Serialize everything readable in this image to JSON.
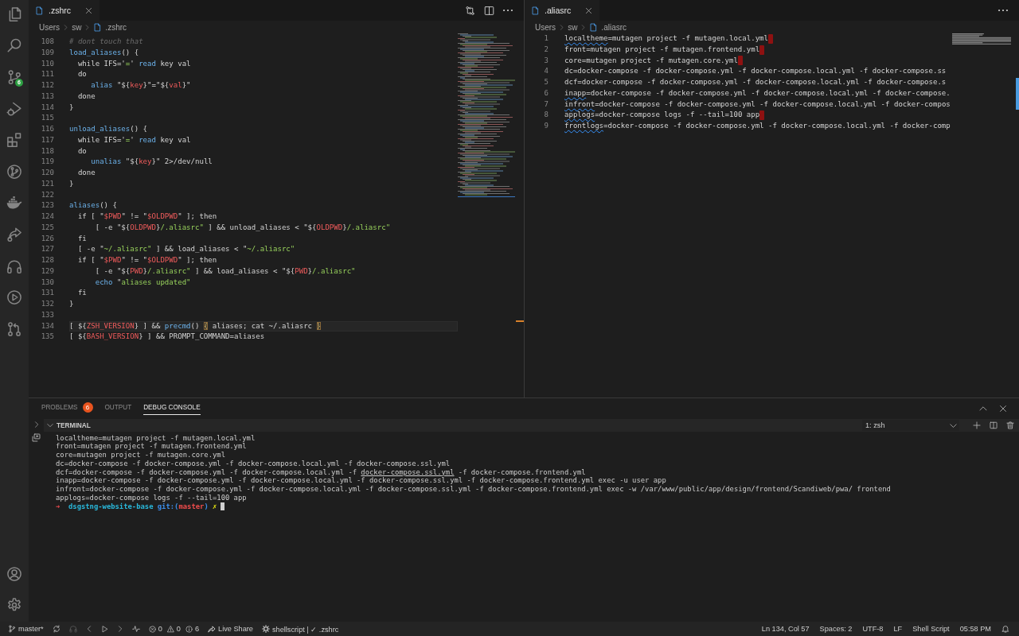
{
  "activity_bar": {
    "badge": "6"
  },
  "editors": [
    {
      "tab": {
        "label": ".zshrc",
        "selected": true
      },
      "breadcrumbs": [
        "Users",
        "sw",
        ".zshrc"
      ],
      "lines": [
        {
          "number": "108",
          "current": false,
          "tokens": [
            {
              "kind": "comment",
              "text": "# dont touch that"
            }
          ]
        },
        {
          "number": "109",
          "current": false,
          "tokens": [
            {
              "kind": "func",
              "text": "load_aliases"
            },
            {
              "kind": "text",
              "text": "() {"
            }
          ]
        },
        {
          "number": "110",
          "current": false,
          "tokens": [
            {
              "kind": "text",
              "text": "  while IFS='"
            },
            {
              "kind": "str",
              "text": "="
            },
            {
              "kind": "text",
              "text": "' "
            },
            {
              "kind": "func",
              "text": "read"
            },
            {
              "kind": "text",
              "text": " key val"
            }
          ]
        },
        {
          "number": "111",
          "current": false,
          "tokens": [
            {
              "kind": "text",
              "text": "  do"
            }
          ]
        },
        {
          "number": "112",
          "current": false,
          "tokens": [
            {
              "kind": "func",
              "text": "     alias"
            },
            {
              "kind": "text",
              "text": " \"${"
            },
            {
              "kind": "var",
              "text": "key"
            },
            {
              "kind": "text",
              "text": "}\"=\"${"
            },
            {
              "kind": "var",
              "text": "val"
            },
            {
              "kind": "text",
              "text": "}\""
            }
          ]
        },
        {
          "number": "113",
          "current": false,
          "tokens": [
            {
              "kind": "text",
              "text": "  done"
            }
          ]
        },
        {
          "number": "114",
          "current": false,
          "tokens": [
            {
              "kind": "text",
              "text": "}"
            }
          ]
        },
        {
          "number": "115",
          "current": false
        },
        {
          "number": "116",
          "current": false,
          "tokens": [
            {
              "kind": "func",
              "text": "unload_aliases"
            },
            {
              "kind": "text",
              "text": "() {"
            }
          ]
        },
        {
          "number": "117",
          "current": false,
          "tokens": [
            {
              "kind": "text",
              "text": "  while IFS='"
            },
            {
              "kind": "str",
              "text": "="
            },
            {
              "kind": "text",
              "text": "' "
            },
            {
              "kind": "func",
              "text": "read"
            },
            {
              "kind": "text",
              "text": " key val"
            }
          ]
        },
        {
          "number": "118",
          "current": false,
          "tokens": [
            {
              "kind": "text",
              "text": "  do"
            }
          ]
        },
        {
          "number": "119",
          "current": false,
          "tokens": [
            {
              "kind": "func",
              "text": "     unalias"
            },
            {
              "kind": "text",
              "text": " \"${"
            },
            {
              "kind": "var",
              "text": "key"
            },
            {
              "kind": "text",
              "text": "}\" 2>/dev/null"
            }
          ]
        },
        {
          "number": "120",
          "current": false,
          "tokens": [
            {
              "kind": "text",
              "text": "  done"
            }
          ]
        },
        {
          "number": "121",
          "current": false,
          "tokens": [
            {
              "kind": "text",
              "text": "}"
            }
          ]
        },
        {
          "number": "122",
          "current": false
        },
        {
          "number": "123",
          "current": false,
          "tokens": [
            {
              "kind": "func",
              "text": "aliases"
            },
            {
              "kind": "text",
              "text": "() {"
            }
          ]
        },
        {
          "number": "124",
          "current": false,
          "tokens": [
            {
              "kind": "text",
              "text": "  if [ \""
            },
            {
              "kind": "var",
              "text": "$PWD"
            },
            {
              "kind": "text",
              "text": "\" != \""
            },
            {
              "kind": "var",
              "text": "$OLDPWD"
            },
            {
              "kind": "text",
              "text": "\" ]; then"
            }
          ]
        },
        {
          "number": "125",
          "current": false,
          "tokens": [
            {
              "kind": "text",
              "text": "      [ -e \"${"
            },
            {
              "kind": "var",
              "text": "OLDPWD"
            },
            {
              "kind": "text",
              "text": "}"
            },
            {
              "kind": "str",
              "text": "/.aliasrc\""
            },
            {
              "kind": "text",
              "text": " ] && unload_aliases < \"${"
            },
            {
              "kind": "var",
              "text": "OLDPWD"
            },
            {
              "kind": "text",
              "text": "}"
            },
            {
              "kind": "str",
              "text": "/.aliasrc\""
            }
          ]
        },
        {
          "number": "126",
          "current": false,
          "tokens": [
            {
              "kind": "text",
              "text": "  fi"
            }
          ]
        },
        {
          "number": "127",
          "current": false,
          "tokens": [
            {
              "kind": "text",
              "text": "  [ -e \""
            },
            {
              "kind": "str",
              "text": "~/.aliasrc\""
            },
            {
              "kind": "text",
              "text": " ] && load_aliases < \""
            },
            {
              "kind": "str",
              "text": "~/.aliasrc\""
            }
          ]
        },
        {
          "number": "128",
          "current": false,
          "tokens": [
            {
              "kind": "text",
              "text": "  if [ \""
            },
            {
              "kind": "var",
              "text": "$PWD"
            },
            {
              "kind": "text",
              "text": "\" != \""
            },
            {
              "kind": "var",
              "text": "$OLDPWD"
            },
            {
              "kind": "text",
              "text": "\" ]; then"
            }
          ]
        },
        {
          "number": "129",
          "current": false,
          "tokens": [
            {
              "kind": "text",
              "text": "      [ -e \"${"
            },
            {
              "kind": "var",
              "text": "PWD"
            },
            {
              "kind": "text",
              "text": "}"
            },
            {
              "kind": "str",
              "text": "/.aliasrc\""
            },
            {
              "kind": "text",
              "text": " ] && load_aliases < \"${"
            },
            {
              "kind": "var",
              "text": "PWD"
            },
            {
              "kind": "text",
              "text": "}"
            },
            {
              "kind": "str",
              "text": "/.aliasrc\""
            }
          ]
        },
        {
          "number": "130",
          "current": false,
          "tokens": [
            {
              "kind": "func",
              "text": "      echo"
            },
            {
              "kind": "text",
              "text": " \""
            },
            {
              "kind": "str",
              "text": "aliases updated\""
            }
          ]
        },
        {
          "number": "131",
          "current": false,
          "tokens": [
            {
              "kind": "text",
              "text": "  fi"
            }
          ]
        },
        {
          "number": "132",
          "current": false,
          "tokens": [
            {
              "kind": "text",
              "text": "}"
            }
          ]
        },
        {
          "number": "133",
          "current": false
        },
        {
          "number": "134",
          "current": true,
          "tokens": [
            {
              "kind": "text",
              "text": "[ ${"
            },
            {
              "kind": "var",
              "text": "ZSH_VERSION"
            },
            {
              "kind": "text",
              "text": "} ] && "
            },
            {
              "kind": "func",
              "text": "precmd"
            },
            {
              "kind": "text",
              "text": "() "
            },
            {
              "kind": "bracket",
              "text": "{"
            },
            {
              "kind": "text",
              "text": " aliases; cat ~/.aliasrc "
            },
            {
              "kind": "bracket",
              "text": "}"
            }
          ]
        },
        {
          "number": "135",
          "current": false,
          "tokens": [
            {
              "kind": "text",
              "text": "[ ${"
            },
            {
              "kind": "var",
              "text": "BASH_VERSION"
            },
            {
              "kind": "text",
              "text": "} ] && PROMPT_COMMAND=aliases"
            }
          ]
        }
      ]
    },
    {
      "tab": {
        "label": ".aliasrc",
        "selected": true
      },
      "breadcrumbs": [
        "Users",
        "sw",
        ".aliasrc"
      ],
      "lines": [
        {
          "number": "1",
          "current": false,
          "trailing_space": true,
          "tokens": [
            {
              "kind": "misspelled",
              "text": "localtheme"
            },
            {
              "kind": "text",
              "text": "=mutagen project -f mutagen.local.yml"
            }
          ]
        },
        {
          "number": "2",
          "current": false,
          "trailing_space": true,
          "tokens": [
            {
              "kind": "text",
              "text": "front=mutagen project -f mutagen.frontend.yml"
            }
          ]
        },
        {
          "number": "3",
          "current": false,
          "trailing_space": true,
          "tokens": [
            {
              "kind": "text",
              "text": "core=mutagen project -f mutagen.core.yml"
            }
          ]
        },
        {
          "number": "4",
          "current": false,
          "trailing_space": false,
          "tokens": [
            {
              "kind": "text",
              "text": "dc=docker-compose -f docker-compose.yml -f docker-compose.local.yml -f docker-compose.ss"
            }
          ]
        },
        {
          "number": "5",
          "current": false,
          "trailing_space": false,
          "tokens": [
            {
              "kind": "text",
              "text": "dcf=docker-compose -f docker-compose.yml -f docker-compose.local.yml -f docker-compose.s"
            }
          ]
        },
        {
          "number": "6",
          "current": false,
          "trailing_space": false,
          "tokens": [
            {
              "kind": "misspelled",
              "text": "inapp"
            },
            {
              "kind": "text",
              "text": "=docker-compose -f docker-compose.yml -f docker-compose.local.yml -f docker-compose."
            }
          ]
        },
        {
          "number": "7",
          "current": false,
          "trailing_space": false,
          "tokens": [
            {
              "kind": "misspelled",
              "text": "infront"
            },
            {
              "kind": "text",
              "text": "=docker-compose -f docker-compose.yml -f docker-compose.local.yml -f docker-compos"
            }
          ]
        },
        {
          "number": "8",
          "current": false,
          "trailing_space": true,
          "tokens": [
            {
              "kind": "misspelled",
              "text": "applogs"
            },
            {
              "kind": "text",
              "text": "=docker-compose logs -f --tail=100 app"
            }
          ]
        },
        {
          "number": "9",
          "current": false,
          "trailing_space": false,
          "tokens": [
            {
              "kind": "misspelled",
              "text": "frontlogs"
            },
            {
              "kind": "text",
              "text": "=docker-compose -f docker-compose.yml -f docker-compose.local.yml -f docker-comp"
            }
          ]
        }
      ]
    }
  ],
  "panel": {
    "tabs": [
      {
        "label": "PROBLEMS",
        "badge": "6",
        "selected": false
      },
      {
        "label": "OUTPUT",
        "selected": false
      },
      {
        "label": "DEBUG CONSOLE",
        "selected": true
      }
    ],
    "section": {
      "title": "TERMINAL",
      "expanded": true
    },
    "terminal_picker": "1: zsh",
    "terminal": {
      "cursor": true,
      "lines": [
        {
          "tokens": [
            {
              "kind": "text",
              "text": "localtheme=mutagen project -f mutagen.local.yml"
            }
          ]
        },
        {
          "tokens": [
            {
              "kind": "text",
              "text": "front=mutagen project -f mutagen.frontend.yml"
            }
          ]
        },
        {
          "tokens": [
            {
              "kind": "text",
              "text": "core=mutagen project -f mutagen.core.yml"
            }
          ]
        },
        {
          "tokens": [
            {
              "kind": "text",
              "text": "dc=docker-compose -f docker-compose.yml -f docker-compose.local.yml -f docker-compose.ssl.yml"
            }
          ]
        },
        {
          "tokens": [
            {
              "kind": "text",
              "text": "dcf=docker-compose -f docker-compose.yml -f docker-compose.local.yml -f "
            },
            {
              "kind": "link",
              "text": "docker-compose.ssl.yml"
            },
            {
              "kind": "text",
              "text": " -f docker-compose.frontend.yml"
            }
          ]
        },
        {
          "tokens": [
            {
              "kind": "text",
              "text": "inapp=docker-compose -f docker-compose.yml -f docker-compose.local.yml -f docker-compose.ssl.yml -f docker-compose.frontend.yml exec -u user app"
            }
          ]
        },
        {
          "tokens": [
            {
              "kind": "text",
              "text": "infront=docker-compose -f docker-compose.yml -f docker-compose.local.yml -f docker-compose.ssl.yml -f docker-compose.frontend.yml exec -w /var/www/public/app/design/frontend/Scandiweb/pwa/ frontend"
            }
          ]
        },
        {
          "tokens": [
            {
              "kind": "text",
              "text": "applogs=docker-compose logs -f --tail=100 app"
            }
          ]
        },
        {
          "tokens": [
            {
              "kind": "arrow",
              "text": "➜"
            },
            {
              "kind": "dir",
              "text": "  dsgstng-website-base"
            },
            {
              "kind": "git",
              "text": " git:("
            },
            {
              "kind": "branch",
              "text": "master"
            },
            {
              "kind": "git",
              "text": ")"
            },
            {
              "kind": "dirty",
              "text": " ✗"
            }
          ]
        }
      ]
    }
  },
  "status_bar": {
    "branch": "master*",
    "problems": {
      "errors": "0",
      "warnings": "0",
      "infos": "6"
    },
    "live_share": "Live Share",
    "language_status": "shellscript | ✓ .zshrc",
    "right": [
      "Ln 134, Col 57",
      "Spaces: 2",
      "UTF-8",
      "LF",
      "Shell Script",
      "05:58 PM"
    ]
  }
}
